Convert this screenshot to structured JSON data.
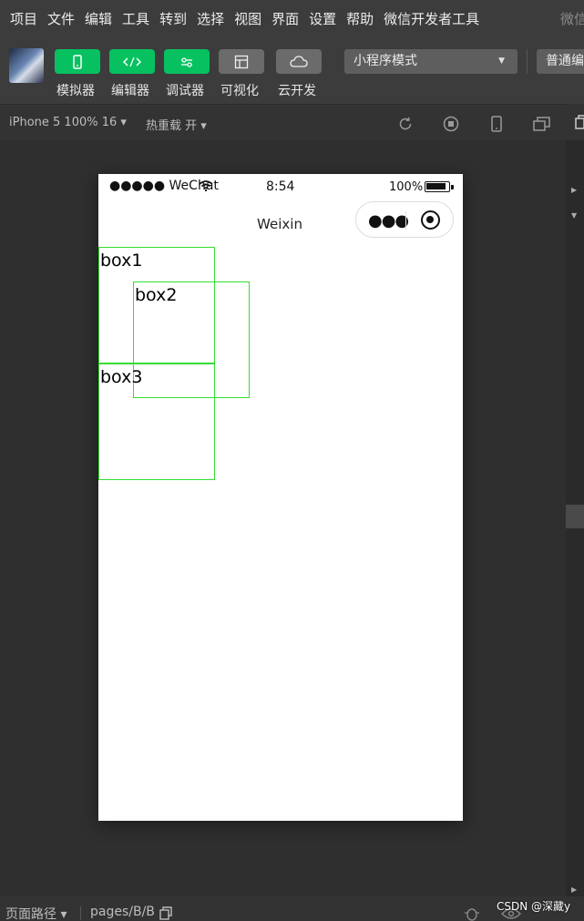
{
  "menu": {
    "items": [
      "项目",
      "文件",
      "编辑",
      "工具",
      "转到",
      "选择",
      "视图",
      "界面",
      "设置",
      "帮助",
      "微信开发者工具"
    ],
    "brand": "微信"
  },
  "toolbar": {
    "buttons": [
      {
        "label": "模拟器",
        "icon": "phone-icon",
        "style": "green"
      },
      {
        "label": "编辑器",
        "icon": "code-icon",
        "style": "green"
      },
      {
        "label": "调试器",
        "icon": "debug-sliders-icon",
        "style": "green"
      },
      {
        "label": "可视化",
        "icon": "layout-icon",
        "style": "gray"
      },
      {
        "label": "云开发",
        "icon": "cloud-icon",
        "style": "gray"
      }
    ],
    "mode_select": "小程序模式",
    "compile_select": "普通编"
  },
  "simbar": {
    "device": "iPhone 5 100% 16 ▾",
    "hot_reload": "热重载 开 ▾",
    "icons": [
      "rotate-icon",
      "stop-icon",
      "device-icon",
      "window-icon"
    ]
  },
  "phone": {
    "carrier": "●●●●● WeChat",
    "time": "8:54",
    "battery": "100%",
    "nav_title": "Weixin",
    "boxes": [
      "box1",
      "box2",
      "box3"
    ]
  },
  "bottombar": {
    "path_label": "页面路径 ▾",
    "page": "pages/B/B",
    "watermark": "CSDN @深藏y"
  },
  "colors": {
    "accent_green": "#07c160",
    "box_border": "#33dd33"
  }
}
